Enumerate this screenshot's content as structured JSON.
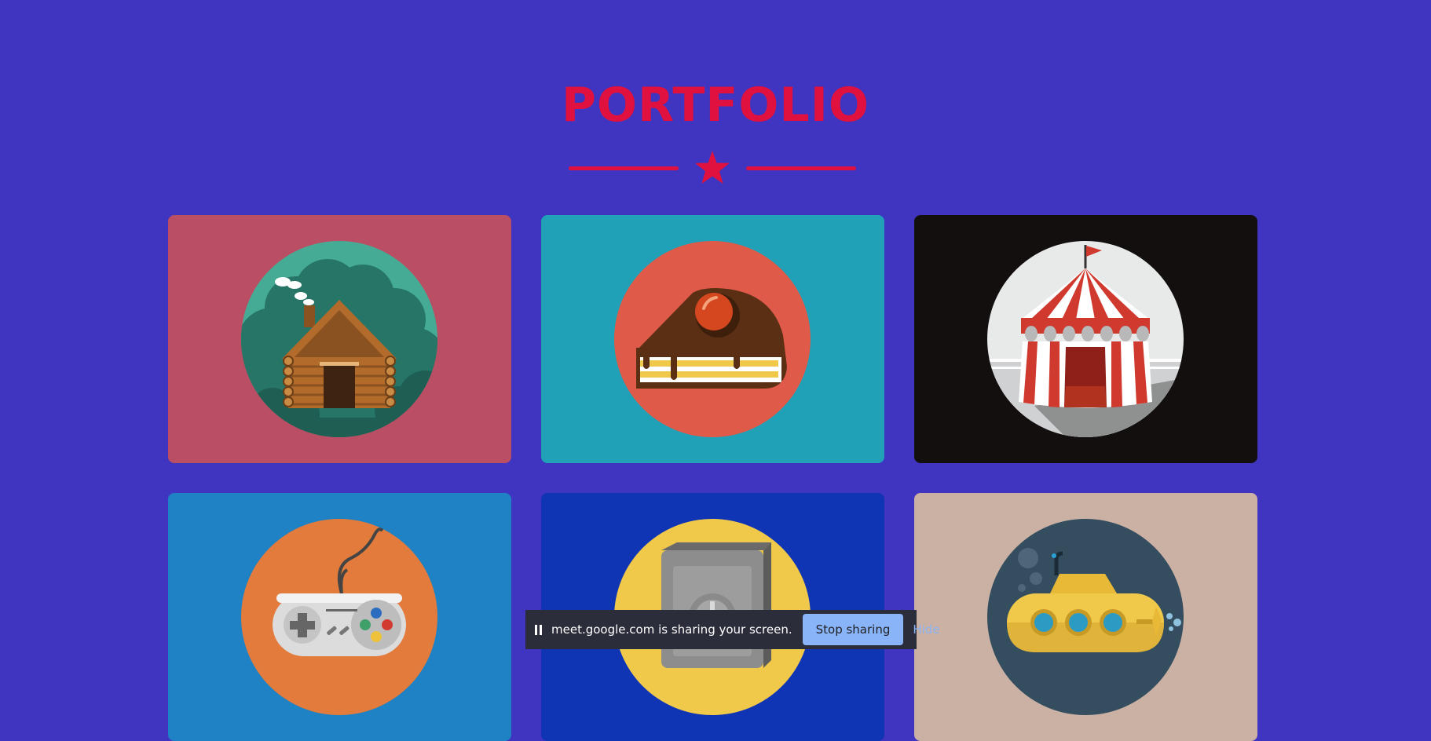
{
  "page": {
    "title": "PORTFOLIO",
    "background_color": "#4035c0",
    "accent_color": "#e0103f",
    "divider_icon": "star-icon"
  },
  "portfolio": {
    "items": [
      {
        "name": "cabin",
        "icon": "log-cabin-icon",
        "bg": "#b94e64",
        "circle": "#45ab95"
      },
      {
        "name": "cake",
        "icon": "cake-slice-icon",
        "bg": "#21a1b7",
        "circle": "#e05a4a"
      },
      {
        "name": "circus",
        "icon": "circus-tent-icon",
        "bg": "#130f0f",
        "circle": "#e8eaea"
      },
      {
        "name": "game",
        "icon": "game-controller-icon",
        "bg": "#1e82c4",
        "circle": "#e27b3b"
      },
      {
        "name": "safe",
        "icon": "safe-icon",
        "bg": "#0f35b5",
        "circle": "#f0c94a"
      },
      {
        "name": "submarine",
        "icon": "submarine-icon",
        "bg": "#cbb1a4",
        "circle": "#344e5f"
      }
    ]
  },
  "share_bar": {
    "message": "meet.google.com is sharing your screen.",
    "stop_label": "Stop sharing",
    "hide_label": "Hide",
    "button_color": "#8ab4f8"
  }
}
